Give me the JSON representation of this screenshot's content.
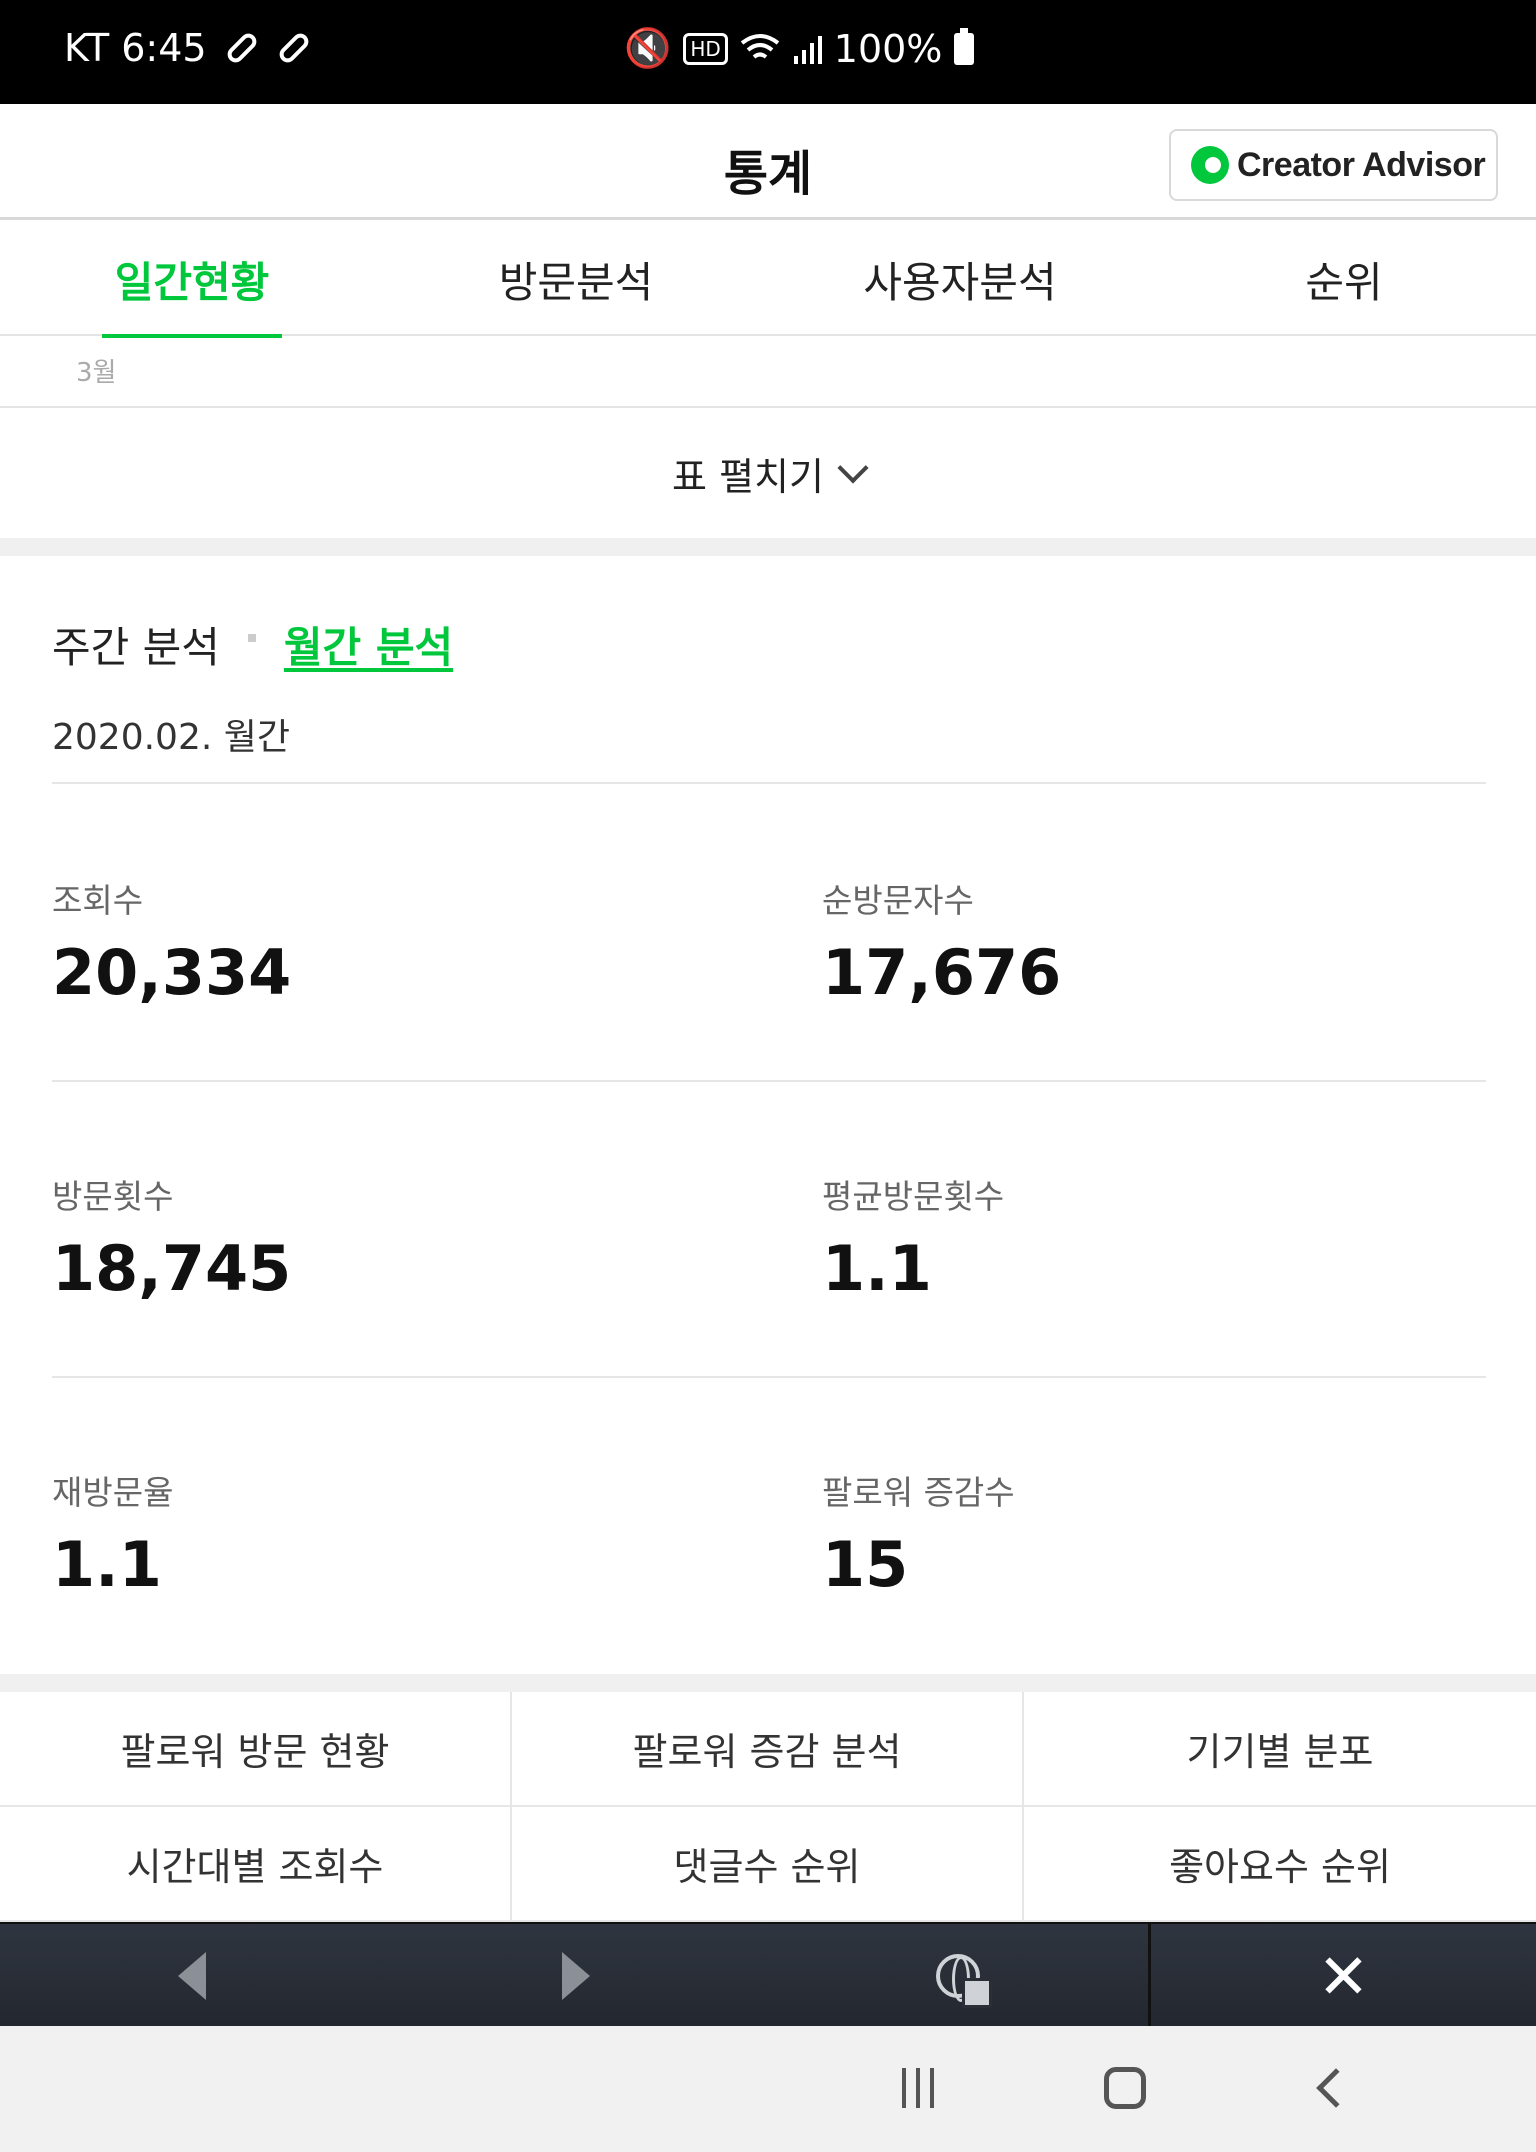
{
  "status_bar": {
    "carrier_time": "KT 6:45",
    "icons": [
      "pill-icon",
      "pill-icon",
      "mute-vibrate-icon",
      "hd-icon",
      "wifi-icon",
      "signal-icon",
      "battery-icon"
    ],
    "hd": "HD",
    "battery": "100%"
  },
  "header": {
    "title": "통계",
    "creator_advisor_label": "Creator Advisor",
    "brand_color": "#00c73c"
  },
  "tabs": [
    {
      "label": "일간현황",
      "active": true
    },
    {
      "label": "방문분석",
      "active": false
    },
    {
      "label": "사용자분석",
      "active": false
    },
    {
      "label": "순위",
      "active": false
    }
  ],
  "table": {
    "month_label": "3월",
    "expand_label": "표 펼치기"
  },
  "analysis": {
    "weekly_label": "주간 분석",
    "monthly_label": "월간 분석",
    "period": "2020.02. 월간",
    "stats": [
      {
        "label": "조회수",
        "value": "20,334"
      },
      {
        "label": "순방문자수",
        "value": "17,676"
      },
      {
        "label": "방문횟수",
        "value": "18,745"
      },
      {
        "label": "평균방문횟수",
        "value": "1.1"
      },
      {
        "label": "재방문율",
        "value": "1.1"
      },
      {
        "label": "팔로워 증감수",
        "value": "15"
      }
    ]
  },
  "menu": [
    "팔로워 방문 현황",
    "팔로워 증감 분석",
    "기기별 분포",
    "시간대별 조회수",
    "댓글수 순위",
    "좋아요수 순위"
  ],
  "browser_toolbar": {
    "icons": [
      "back-arrow-icon",
      "forward-arrow-icon",
      "globe-shortcut-icon",
      "close-icon"
    ],
    "close_symbol": "✕"
  },
  "nav_bar": {
    "icons": [
      "recent-apps-icon",
      "home-icon",
      "back-icon"
    ]
  }
}
